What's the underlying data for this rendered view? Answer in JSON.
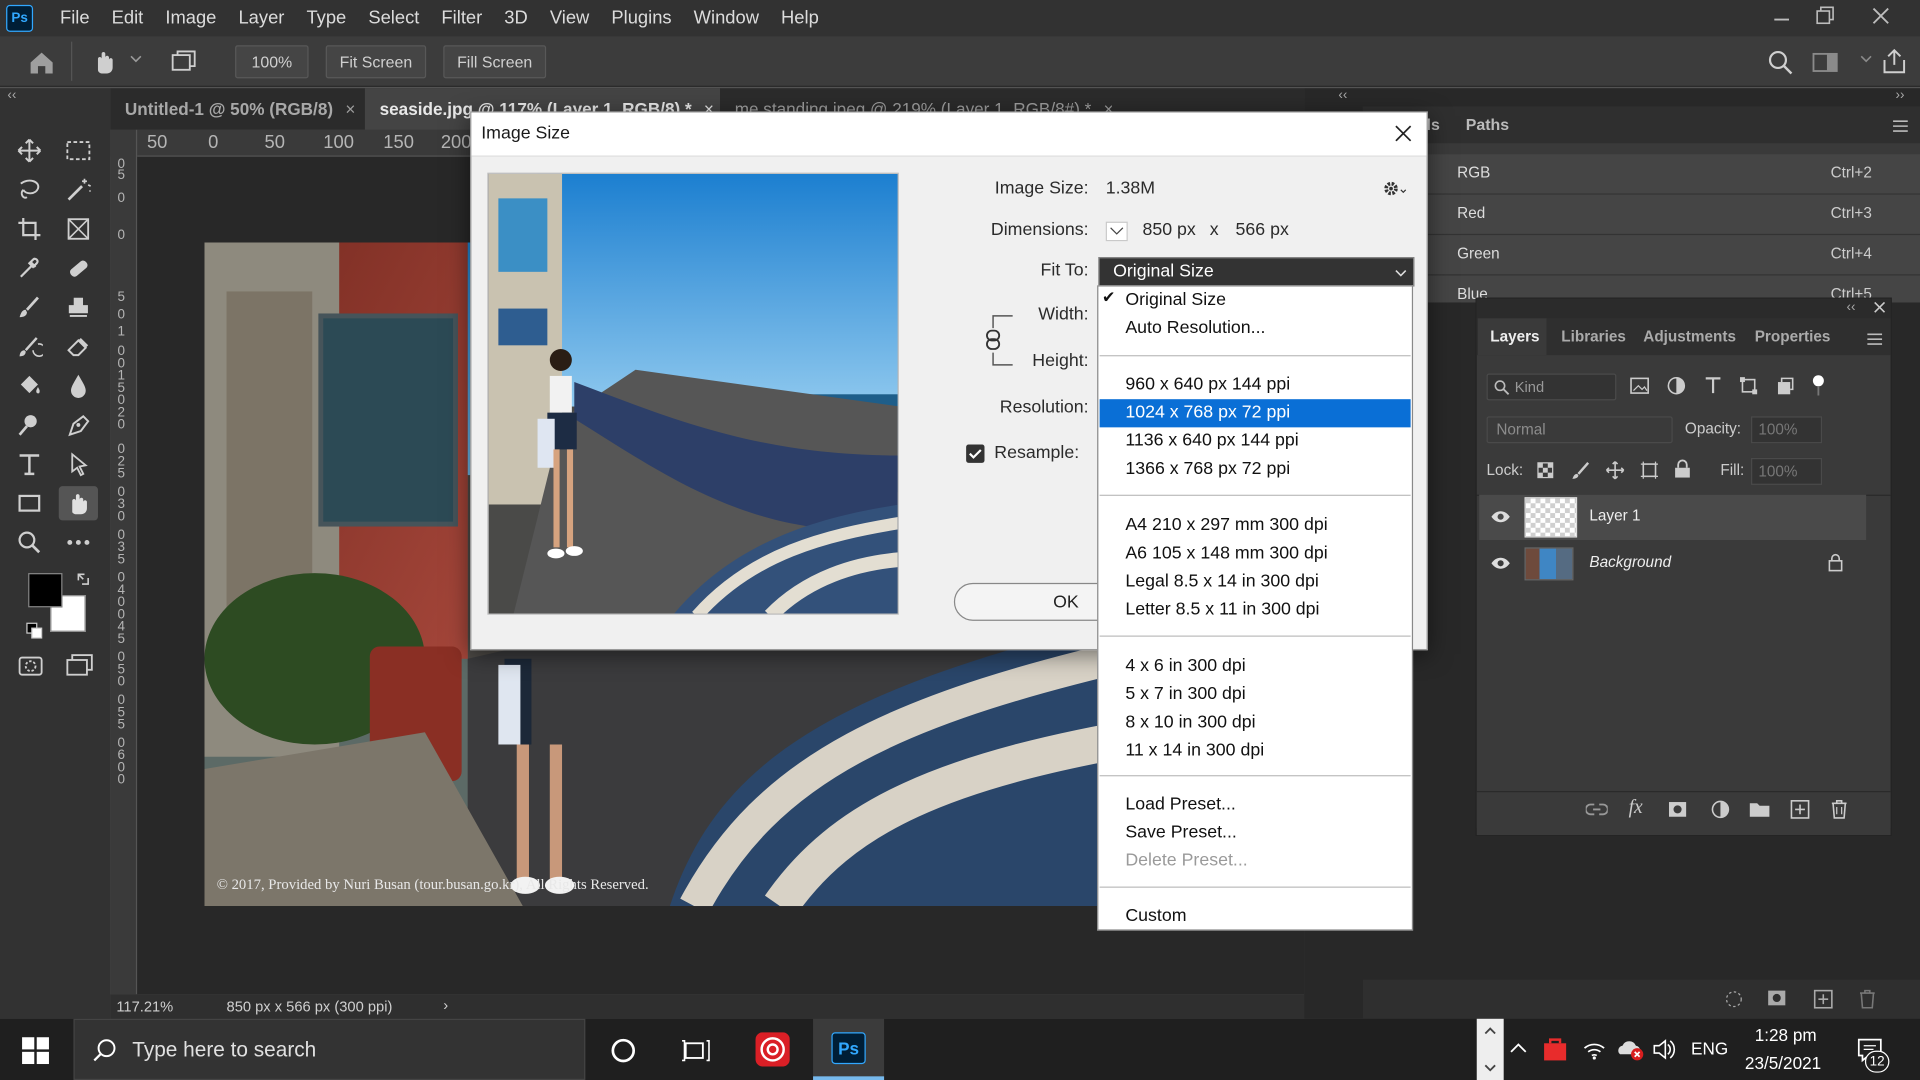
{
  "app": {
    "logo_text": "Ps",
    "menu": [
      "File",
      "Edit",
      "Image",
      "Layer",
      "Type",
      "Select",
      "Filter",
      "3D",
      "View",
      "Plugins",
      "Window",
      "Help"
    ],
    "window_controls": {
      "minimize": "minimize-icon",
      "restore": "restore-icon",
      "close": "close-icon"
    }
  },
  "options_bar": {
    "zoom_value": "100%",
    "fit_screen": "Fit Screen",
    "fill_screen": "Fill Screen"
  },
  "panel_collapse": {
    "left": "‹‹",
    "right": "››",
    "doc": "‹‹"
  },
  "tabs": [
    {
      "label": "Untitled-1 @ 50% (RGB/8)",
      "close": "×"
    },
    {
      "label": "seaside.jpg @ 117% (Layer 1, RGB/8) *",
      "close": "×"
    },
    {
      "label": "me standing.jpeg @ 219% (Layer 1, RGB/8#) *",
      "close": "×"
    }
  ],
  "ruler": {
    "h_ticks": [
      "50",
      "0",
      "50",
      "100",
      "150",
      "200"
    ],
    "v_ticks": [
      "0",
      "5",
      "0",
      "0",
      "5",
      "0",
      "1",
      "0",
      "0",
      "1",
      "5",
      "0",
      "2",
      "0",
      "0",
      "2",
      "5",
      "0",
      "3",
      "0",
      "0",
      "3",
      "5",
      "0",
      "4",
      "0",
      "0",
      "4",
      "5",
      "0",
      "5",
      "0",
      "0",
      "5",
      "5",
      "0",
      "6",
      "0",
      "0"
    ]
  },
  "canvas": {
    "copyright": "© 2017, Provided by Nuri Busan (tour.busan.go.kr), All Rights Reserved."
  },
  "status": {
    "zoom": "117.21%",
    "doc_info": "850 px x 566 px (300 ppi)",
    "arrow": "›"
  },
  "dialog": {
    "title": "Image Size",
    "image_size_label": "Image Size:",
    "image_size_value": "1.38M",
    "dimensions_label": "Dimensions:",
    "dim_w": "850 px",
    "dim_x": "x",
    "dim_h": "566 px",
    "fit_to_label": "Fit To:",
    "fit_to_value": "Original Size",
    "width_label": "Width:",
    "height_label": "Height:",
    "resolution_label": "Resolution:",
    "resample_label": "Resample:",
    "ok_label": "OK",
    "checkmark": "✔"
  },
  "fit_dropdown": {
    "items": [
      {
        "label": "Original Size"
      },
      {
        "label": "Auto Resolution..."
      },
      {
        "label": "960 x 640 px 144 ppi"
      },
      {
        "label": "1024 x 768 px 72 ppi"
      },
      {
        "label": "1136 x 640 px 144 ppi"
      },
      {
        "label": "1366 x 768 px 72 ppi"
      },
      {
        "label": "A4 210 x 297 mm 300 dpi"
      },
      {
        "label": "A6 105 x 148 mm 300 dpi"
      },
      {
        "label": "Legal 8.5 x 14 in 300 dpi"
      },
      {
        "label": "Letter 8.5 x 11 in 300 dpi"
      },
      {
        "label": "4 x 6 in 300 dpi"
      },
      {
        "label": "5 x 7 in 300 dpi"
      },
      {
        "label": "8 x 10 in 300 dpi"
      },
      {
        "label": "11 x 14 in 300 dpi"
      },
      {
        "label": "Load Preset..."
      },
      {
        "label": "Save Preset..."
      },
      {
        "label": "Delete Preset..."
      },
      {
        "label": "Custom"
      }
    ],
    "selected": "1024 x 768 px 72 ppi",
    "checked": "Original Size"
  },
  "channels_panel": {
    "tabs": [
      "ls",
      "Paths"
    ],
    "rows": [
      {
        "name": "RGB",
        "shortcut": "Ctrl+2"
      },
      {
        "name": "Red",
        "shortcut": "Ctrl+3"
      },
      {
        "name": "Green",
        "shortcut": "Ctrl+4"
      },
      {
        "name": "Blue",
        "shortcut": "Ctrl+5"
      }
    ]
  },
  "layers_panel": {
    "tabs": [
      "Layers",
      "Libraries",
      "Adjustments",
      "Properties"
    ],
    "kind_placeholder": "Kind",
    "blend_mode": "Normal",
    "opacity_label": "Opacity:",
    "opacity_value": "100%",
    "lock_label": "Lock:",
    "fill_label": "Fill:",
    "fill_value": "100%",
    "layers": [
      {
        "name": "Layer 1"
      },
      {
        "name": "Background"
      }
    ]
  },
  "taskbar": {
    "search_placeholder": "Type here to search",
    "time": "1:28 pm",
    "date": "23/5/2021",
    "lang": "ENG",
    "notif_count": "12"
  }
}
